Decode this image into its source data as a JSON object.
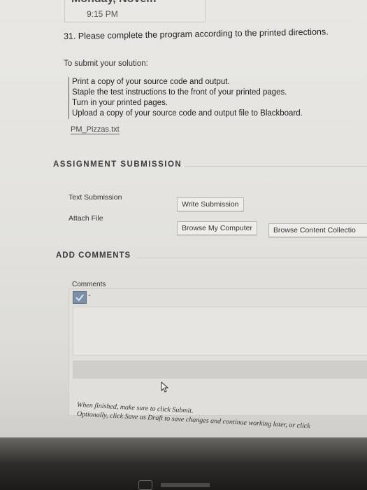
{
  "header": {
    "date": "Monday, Novem",
    "time": "9:15 PM"
  },
  "question": {
    "text": "31. Please complete the program according to the printed directions.",
    "submit_label": "To submit your solution:",
    "instructions": [
      "Print a copy of your source code and output.",
      "Staple the test instructions to the front of your printed pages.",
      "Turn in your printed pages.",
      "Upload a copy of your source code and output file to Blackboard."
    ],
    "attachment": "PM_Pizzas.txt"
  },
  "assignment_submission": {
    "title": "ASSIGNMENT SUBMISSION",
    "text_submission_label": "Text Submission",
    "write_submission_button": "Write Submission",
    "attach_file_label": "Attach File",
    "browse_computer_button": "Browse My Computer",
    "browse_content_button": "Browse Content Collectio"
  },
  "add_comments": {
    "title": "ADD COMMENTS",
    "comments_label": "Comments",
    "dropdown_indicator": "-"
  },
  "footer": {
    "line1": "When finished, make sure to click Submit.",
    "line2": "Optionally, click Save as Draft to save changes and continue working later, or click"
  },
  "colors": {
    "page_background": "#e6e5e1",
    "button_background": "#eeede9",
    "editor_icon": "#7a8fa8",
    "taskbar": "#1b1a19"
  },
  "icons": {
    "spellcheck": "spellcheck-icon",
    "cursor": "mouse-cursor-icon",
    "taskbar": "taskbar-app-icon"
  }
}
